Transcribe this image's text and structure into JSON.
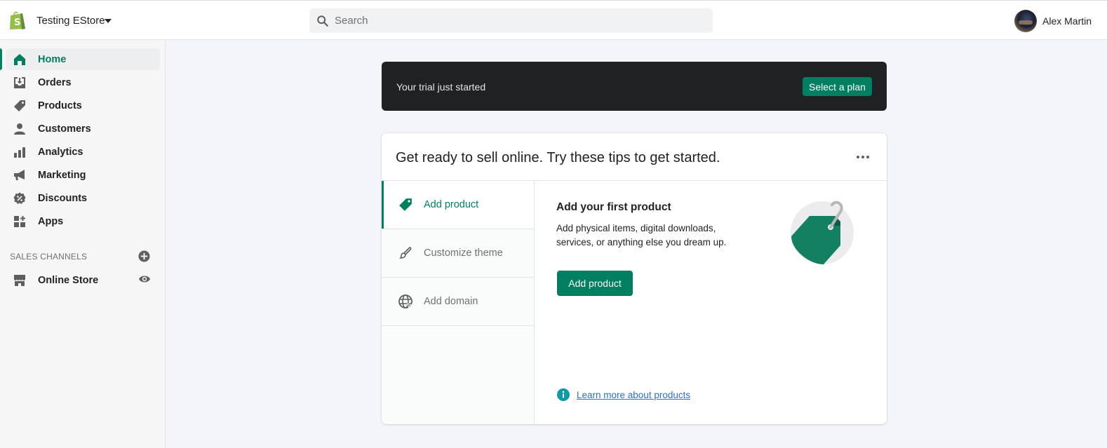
{
  "topbar": {
    "store_name": "Testing EStore",
    "search_placeholder": "Search",
    "search_value": "",
    "user_name": "Alex Martin"
  },
  "sidebar": {
    "items": [
      {
        "label": "Home",
        "icon": "home-icon",
        "active": true
      },
      {
        "label": "Orders",
        "icon": "orders-icon"
      },
      {
        "label": "Products",
        "icon": "tag-icon"
      },
      {
        "label": "Customers",
        "icon": "person-icon"
      },
      {
        "label": "Analytics",
        "icon": "bar-chart-icon"
      },
      {
        "label": "Marketing",
        "icon": "megaphone-icon"
      },
      {
        "label": "Discounts",
        "icon": "discount-icon"
      },
      {
        "label": "Apps",
        "icon": "apps-icon"
      }
    ],
    "sales_channels_label": "SALES CHANNELS",
    "channels": [
      {
        "label": "Online Store",
        "icon": "store-icon"
      }
    ]
  },
  "trial_banner": {
    "text": "Your trial just started",
    "button_label": "Select a plan"
  },
  "setup_card": {
    "title": "Get ready to sell online. Try these tips to get started.",
    "tabs": [
      {
        "label": "Add product",
        "icon": "tag-icon",
        "active": true
      },
      {
        "label": "Customize theme",
        "icon": "paintbrush-icon"
      },
      {
        "label": "Add domain",
        "icon": "globe-icon"
      }
    ],
    "pane": {
      "title": "Add your first product",
      "description": "Add physical items, digital downloads, services, or anything else you dream up.",
      "button_label": "Add product",
      "learn_more": "Learn more about products"
    }
  },
  "colors": {
    "accent": "#008060",
    "banner_bg": "#202123",
    "link": "#2c6ecb",
    "info": "#0e9aa7"
  }
}
